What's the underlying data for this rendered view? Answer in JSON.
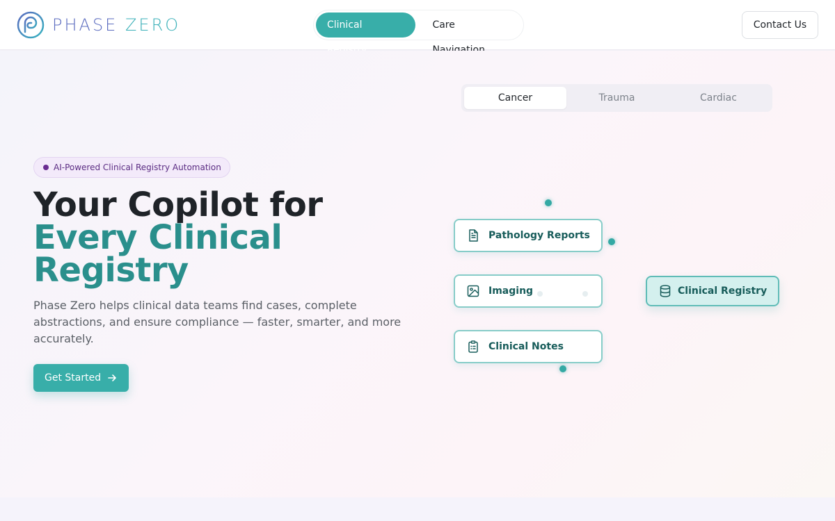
{
  "brand": {
    "name_part1": "PHASE ",
    "name_part2": "ZERO",
    "primary_color": "#38aea9",
    "logo_color": "#5a6bbf"
  },
  "nav": {
    "tabs": [
      {
        "label": "Clinical Registry",
        "active": true
      },
      {
        "label": "Care Navigation",
        "active": false
      }
    ],
    "contact_label": "Contact Us"
  },
  "hero": {
    "badge": "AI-Powered Clinical Registry Automation",
    "headline_line1": "Your Copilot for",
    "headline_line2": "Every Clinical Registry",
    "subtext": "Phase Zero helps clinical data teams find cases, complete abstractions, and ensure compliance — faster, smarter, and more accurately.",
    "cta_label": "Get Started"
  },
  "registry_types": {
    "tabs": [
      {
        "label": "Cancer",
        "active": true
      },
      {
        "label": "Trauma",
        "active": false
      },
      {
        "label": "Cardiac",
        "active": false
      }
    ]
  },
  "diagram": {
    "sources": [
      {
        "label": "Pathology Reports",
        "icon": "file-text-icon"
      },
      {
        "label": "Imaging",
        "icon": "image-icon"
      },
      {
        "label": "Clinical Notes",
        "icon": "clipboard-list-icon"
      }
    ],
    "target": {
      "label": "Clinical Registry",
      "icon": "database-icon"
    }
  }
}
